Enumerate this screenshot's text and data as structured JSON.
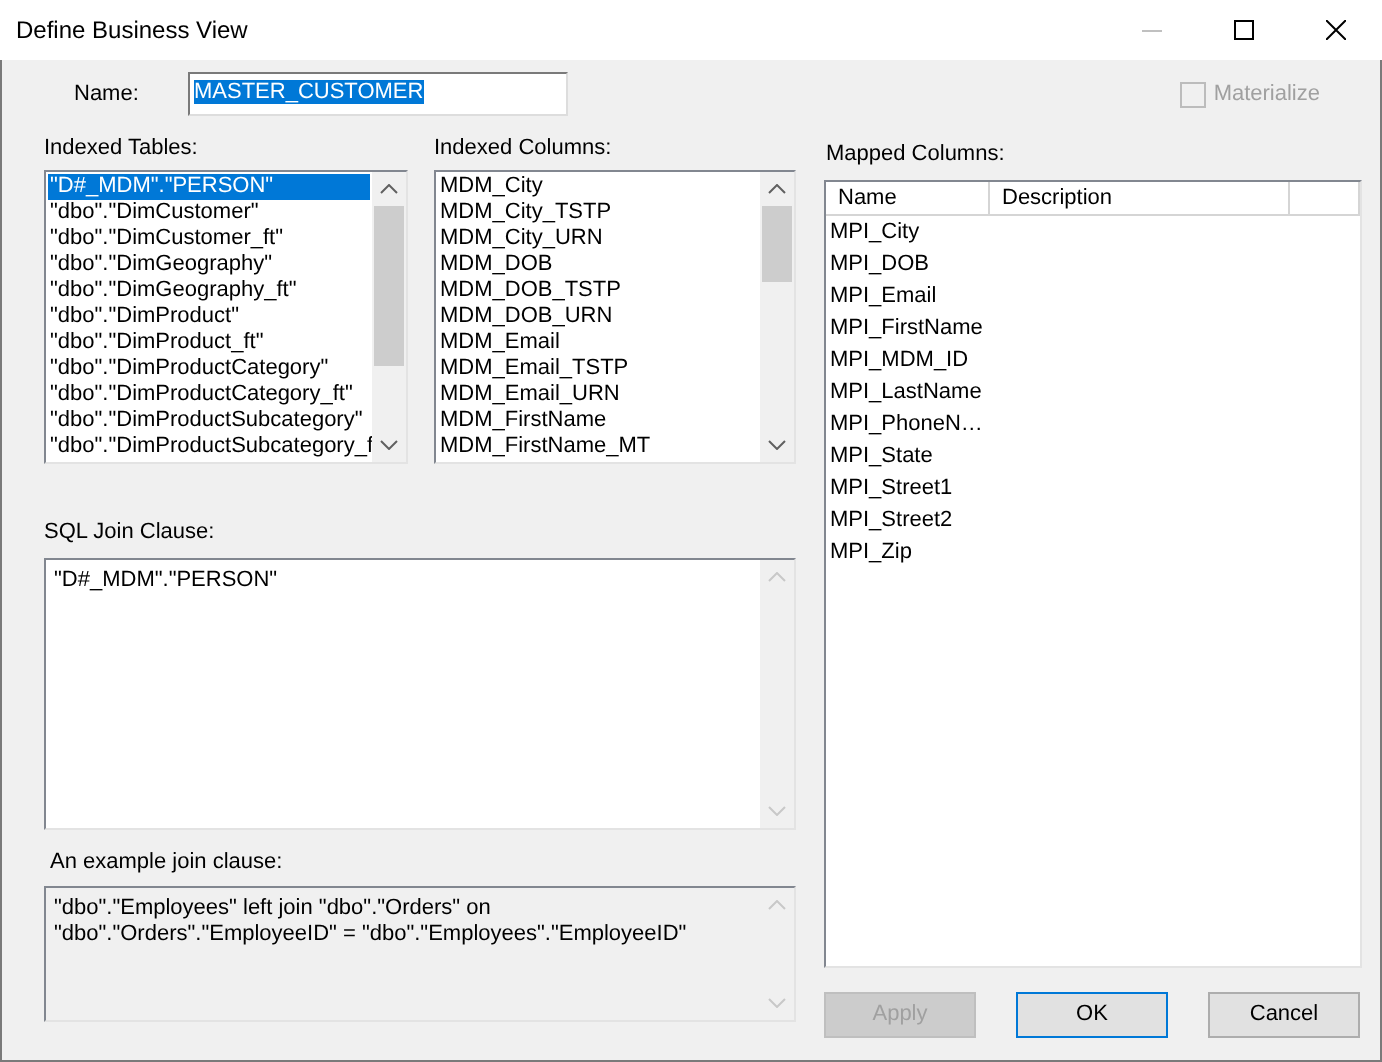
{
  "window": {
    "title": "Define Business View"
  },
  "name_field": {
    "label": "Name:",
    "value": "MASTER_CUSTOMER",
    "selected": true
  },
  "materialize": {
    "label": "Materialize",
    "checked": false,
    "disabled": true
  },
  "indexed_tables": {
    "label": "Indexed Tables:",
    "items": [
      {
        "text": "\"D#_MDM\".\"PERSON\"",
        "selected": true
      },
      {
        "text": "\"dbo\".\"DimCustomer\"",
        "selected": false
      },
      {
        "text": "\"dbo\".\"DimCustomer_ft\"",
        "selected": false
      },
      {
        "text": "\"dbo\".\"DimGeography\"",
        "selected": false
      },
      {
        "text": "\"dbo\".\"DimGeography_ft\"",
        "selected": false
      },
      {
        "text": "\"dbo\".\"DimProduct\"",
        "selected": false
      },
      {
        "text": "\"dbo\".\"DimProduct_ft\"",
        "selected": false
      },
      {
        "text": "\"dbo\".\"DimProductCategory\"",
        "selected": false
      },
      {
        "text": "\"dbo\".\"DimProductCategory_ft\"",
        "selected": false
      },
      {
        "text": "\"dbo\".\"DimProductSubcategory\"",
        "selected": false
      },
      {
        "text": "\"dbo\".\"DimProductSubcategory_f",
        "selected": false
      }
    ]
  },
  "indexed_columns": {
    "label": "Indexed Columns:",
    "items": [
      {
        "text": "MDM_City",
        "selected": false
      },
      {
        "text": "MDM_City_TSTP",
        "selected": false
      },
      {
        "text": "MDM_City_URN",
        "selected": false
      },
      {
        "text": "MDM_DOB",
        "selected": false
      },
      {
        "text": "MDM_DOB_TSTP",
        "selected": false
      },
      {
        "text": "MDM_DOB_URN",
        "selected": false
      },
      {
        "text": "MDM_Email",
        "selected": false
      },
      {
        "text": "MDM_Email_TSTP",
        "selected": false
      },
      {
        "text": "MDM_Email_URN",
        "selected": false
      },
      {
        "text": "MDM_FirstName",
        "selected": false
      },
      {
        "text": "MDM_FirstName_MT",
        "selected": false
      }
    ]
  },
  "sql_join_clause": {
    "label": "SQL Join Clause:",
    "value": "\"D#_MDM\".\"PERSON\""
  },
  "example_join_clause": {
    "label": "An example join clause:",
    "value": "\"dbo\".\"Employees\" left join \"dbo\".\"Orders\" on\n\"dbo\".\"Orders\".\"EmployeeID\" = \"dbo\".\"Employees\".\"EmployeeID\""
  },
  "mapped_columns": {
    "label": "Mapped Columns:",
    "columns": [
      "Name",
      "Description"
    ],
    "rows": [
      {
        "name": "MPI_City"
      },
      {
        "name": "MPI_DOB"
      },
      {
        "name": "MPI_Email"
      },
      {
        "name": "MPI_FirstName"
      },
      {
        "name": "MPI_MDM_ID"
      },
      {
        "name": "MPI_LastName"
      },
      {
        "name": "MPI_PhoneN…"
      },
      {
        "name": "MPI_State"
      },
      {
        "name": "MPI_Street1"
      },
      {
        "name": "MPI_Street2"
      },
      {
        "name": "MPI_Zip"
      }
    ]
  },
  "buttons": [
    {
      "label": "Apply",
      "disabled": true
    },
    {
      "label": "OK",
      "disabled": false
    },
    {
      "label": "Cancel",
      "disabled": false
    }
  ]
}
